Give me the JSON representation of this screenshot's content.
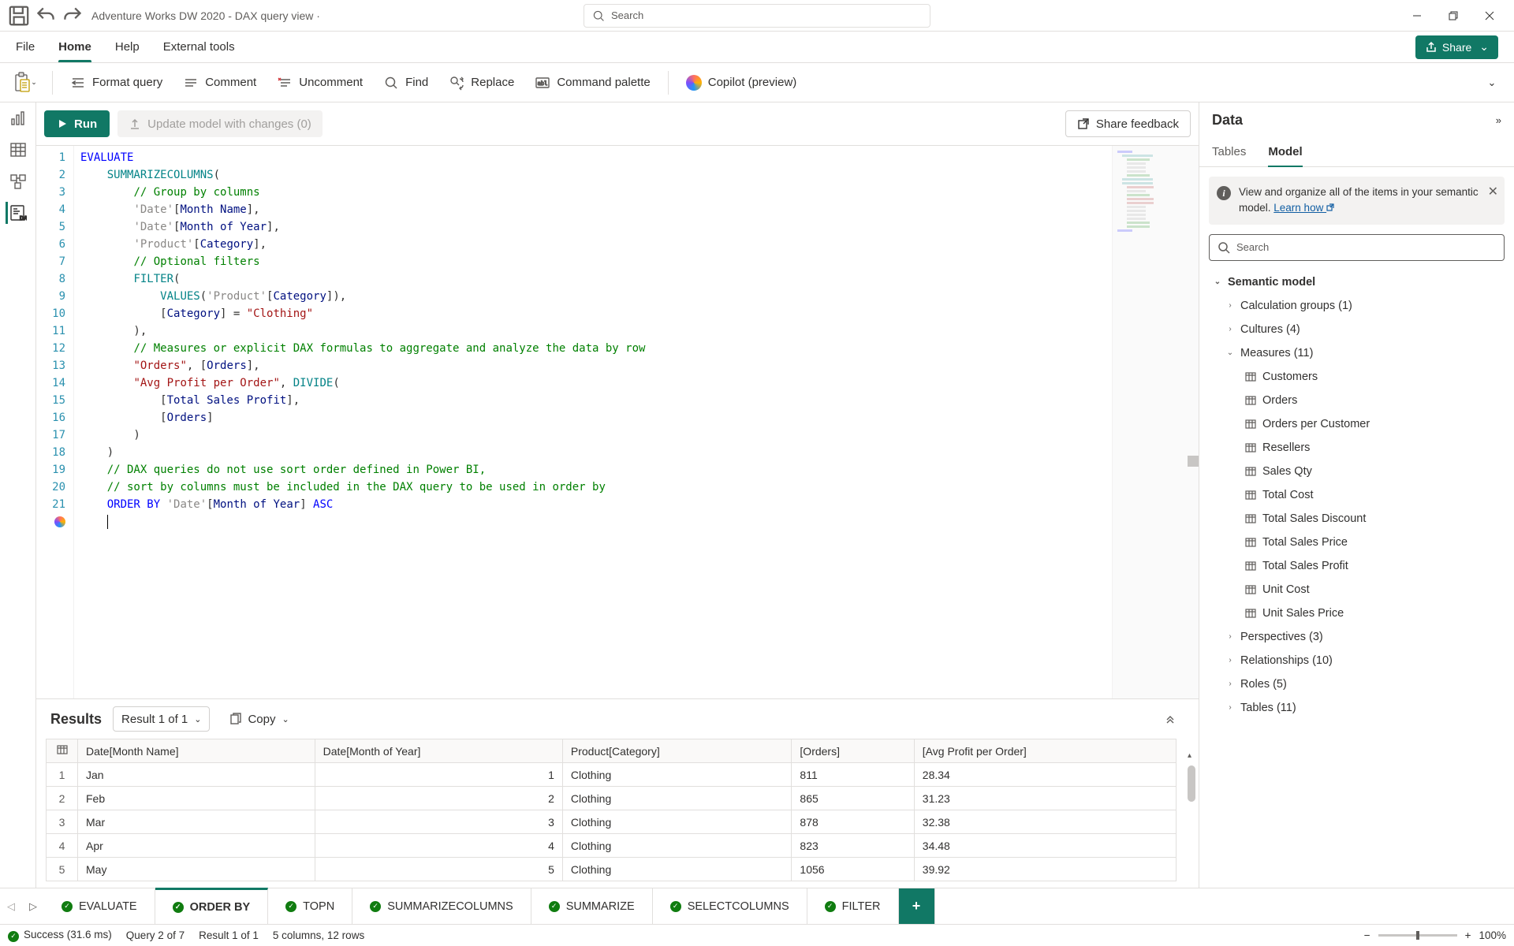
{
  "titlebar": {
    "title": "Adventure Works DW 2020 - DAX query view ·",
    "search_placeholder": "Search"
  },
  "ribbon_tabs": [
    "File",
    "Home",
    "Help",
    "External tools"
  ],
  "ribbon_active": 1,
  "share_label": "Share",
  "toolbar": {
    "format": "Format query",
    "comment": "Comment",
    "uncomment": "Uncomment",
    "find": "Find",
    "replace": "Replace",
    "palette": "Command palette",
    "copilot": "Copilot (preview)"
  },
  "actions": {
    "run": "Run",
    "update": "Update model with changes (0)",
    "feedback": "Share feedback"
  },
  "code_lines": [
    {
      "n": 1,
      "seg": [
        {
          "t": "EVALUATE",
          "c": "kw"
        }
      ]
    },
    {
      "n": 2,
      "seg": [
        {
          "t": "    "
        },
        {
          "t": "SUMMARIZECOLUMNS",
          "c": "fn"
        },
        {
          "t": "("
        }
      ]
    },
    {
      "n": 3,
      "seg": [
        {
          "t": "        "
        },
        {
          "t": "// Group by columns",
          "c": "cmt"
        }
      ]
    },
    {
      "n": 4,
      "seg": [
        {
          "t": "        "
        },
        {
          "t": "'Date'",
          "c": "tbl"
        },
        {
          "t": "["
        },
        {
          "t": "Month Name",
          "c": "col"
        },
        {
          "t": "],"
        }
      ]
    },
    {
      "n": 5,
      "seg": [
        {
          "t": "        "
        },
        {
          "t": "'Date'",
          "c": "tbl"
        },
        {
          "t": "["
        },
        {
          "t": "Month of Year",
          "c": "col"
        },
        {
          "t": "],"
        }
      ]
    },
    {
      "n": 6,
      "seg": [
        {
          "t": "        "
        },
        {
          "t": "'Product'",
          "c": "tbl"
        },
        {
          "t": "["
        },
        {
          "t": "Category",
          "c": "col"
        },
        {
          "t": "],"
        }
      ]
    },
    {
      "n": 7,
      "seg": [
        {
          "t": "        "
        },
        {
          "t": "// Optional filters",
          "c": "cmt"
        }
      ]
    },
    {
      "n": 8,
      "seg": [
        {
          "t": "        "
        },
        {
          "t": "FILTER",
          "c": "fn"
        },
        {
          "t": "("
        }
      ]
    },
    {
      "n": 9,
      "seg": [
        {
          "t": "            "
        },
        {
          "t": "VALUES",
          "c": "fn"
        },
        {
          "t": "("
        },
        {
          "t": "'Product'",
          "c": "tbl"
        },
        {
          "t": "["
        },
        {
          "t": "Category",
          "c": "col"
        },
        {
          "t": "]),"
        }
      ]
    },
    {
      "n": 10,
      "seg": [
        {
          "t": "            ["
        },
        {
          "t": "Category",
          "c": "col"
        },
        {
          "t": "] = "
        },
        {
          "t": "\"Clothing\"",
          "c": "str"
        }
      ]
    },
    {
      "n": 11,
      "seg": [
        {
          "t": "        ),"
        }
      ]
    },
    {
      "n": 12,
      "seg": [
        {
          "t": "        "
        },
        {
          "t": "// Measures or explicit DAX formulas to aggregate and analyze the data by row",
          "c": "cmt"
        }
      ]
    },
    {
      "n": 13,
      "seg": [
        {
          "t": "        "
        },
        {
          "t": "\"Orders\"",
          "c": "str"
        },
        {
          "t": ", ["
        },
        {
          "t": "Orders",
          "c": "col"
        },
        {
          "t": "],"
        }
      ]
    },
    {
      "n": 14,
      "seg": [
        {
          "t": "        "
        },
        {
          "t": "\"Avg Profit per Order\"",
          "c": "str"
        },
        {
          "t": ", "
        },
        {
          "t": "DIVIDE",
          "c": "fn"
        },
        {
          "t": "("
        }
      ]
    },
    {
      "n": 15,
      "seg": [
        {
          "t": "            ["
        },
        {
          "t": "Total Sales Profit",
          "c": "col"
        },
        {
          "t": "],"
        }
      ]
    },
    {
      "n": 16,
      "seg": [
        {
          "t": "            ["
        },
        {
          "t": "Orders",
          "c": "col"
        },
        {
          "t": "]"
        }
      ]
    },
    {
      "n": 17,
      "seg": [
        {
          "t": "        )"
        }
      ]
    },
    {
      "n": 18,
      "seg": [
        {
          "t": "    )"
        }
      ]
    },
    {
      "n": 19,
      "seg": [
        {
          "t": "    "
        },
        {
          "t": "// DAX queries do not use sort order defined in Power BI,",
          "c": "cmt"
        }
      ]
    },
    {
      "n": 20,
      "seg": [
        {
          "t": "    "
        },
        {
          "t": "// sort by columns must be included in the DAX query to be used in order by",
          "c": "cmt"
        }
      ]
    },
    {
      "n": 21,
      "seg": [
        {
          "t": "    "
        },
        {
          "t": "ORDER BY",
          "c": "kw"
        },
        {
          "t": " "
        },
        {
          "t": "'Date'",
          "c": "tbl"
        },
        {
          "t": "["
        },
        {
          "t": "Month of Year",
          "c": "col"
        },
        {
          "t": "] "
        },
        {
          "t": "ASC",
          "c": "kw"
        }
      ]
    },
    {
      "n": 22,
      "seg": [
        {
          "t": "    "
        }
      ],
      "cursor": true,
      "copilot": true
    }
  ],
  "results": {
    "title": "Results",
    "result_selector": "Result 1 of 1",
    "copy_label": "Copy",
    "columns": [
      "Date[Month Name]",
      "Date[Month of Year]",
      "Product[Category]",
      "[Orders]",
      "[Avg Profit per Order]"
    ],
    "rows": [
      [
        "Jan",
        "1",
        "Clothing",
        "811",
        "28.34"
      ],
      [
        "Feb",
        "2",
        "Clothing",
        "865",
        "31.23"
      ],
      [
        "Mar",
        "3",
        "Clothing",
        "878",
        "32.38"
      ],
      [
        "Apr",
        "4",
        "Clothing",
        "823",
        "34.48"
      ],
      [
        "May",
        "5",
        "Clothing",
        "1056",
        "39.92"
      ]
    ]
  },
  "data_panel": {
    "title": "Data",
    "tabs": [
      "Tables",
      "Model"
    ],
    "tabs_active": 1,
    "info_text": "View and organize all of the items in your semantic model. ",
    "info_link": "Learn how ",
    "search_placeholder": "Search",
    "tree": [
      {
        "level": 1,
        "expanded": true,
        "label": "Semantic model"
      },
      {
        "level": 2,
        "expanded": false,
        "label": "Calculation groups (1)"
      },
      {
        "level": 2,
        "expanded": false,
        "label": "Cultures (4)"
      },
      {
        "level": 2,
        "expanded": true,
        "label": "Measures (11)"
      },
      {
        "level": 3,
        "icon": "measure",
        "label": "Customers"
      },
      {
        "level": 3,
        "icon": "measure",
        "label": "Orders"
      },
      {
        "level": 3,
        "icon": "measure",
        "label": "Orders per Customer"
      },
      {
        "level": 3,
        "icon": "measure",
        "label": "Resellers"
      },
      {
        "level": 3,
        "icon": "measure",
        "label": "Sales Qty"
      },
      {
        "level": 3,
        "icon": "measure",
        "label": "Total Cost"
      },
      {
        "level": 3,
        "icon": "measure",
        "label": "Total Sales Discount"
      },
      {
        "level": 3,
        "icon": "measure",
        "label": "Total Sales Price"
      },
      {
        "level": 3,
        "icon": "measure",
        "label": "Total Sales Profit"
      },
      {
        "level": 3,
        "icon": "measure",
        "label": "Unit Cost"
      },
      {
        "level": 3,
        "icon": "measure",
        "label": "Unit Sales Price"
      },
      {
        "level": 2,
        "expanded": false,
        "label": "Perspectives (3)"
      },
      {
        "level": 2,
        "expanded": false,
        "label": "Relationships (10)"
      },
      {
        "level": 2,
        "expanded": false,
        "label": "Roles (5)"
      },
      {
        "level": 2,
        "expanded": false,
        "label": "Tables (11)"
      }
    ]
  },
  "query_tabs": [
    "EVALUATE",
    "ORDER BY",
    "TOPN",
    "SUMMARIZECOLUMNS",
    "SUMMARIZE",
    "SELECTCOLUMNS",
    "FILTER"
  ],
  "query_tabs_active": 1,
  "status": {
    "success": "Success (31.6 ms)",
    "query": "Query 2 of 7",
    "result": "Result 1 of 1",
    "shape": "5 columns, 12 rows",
    "zoom": "100%"
  }
}
